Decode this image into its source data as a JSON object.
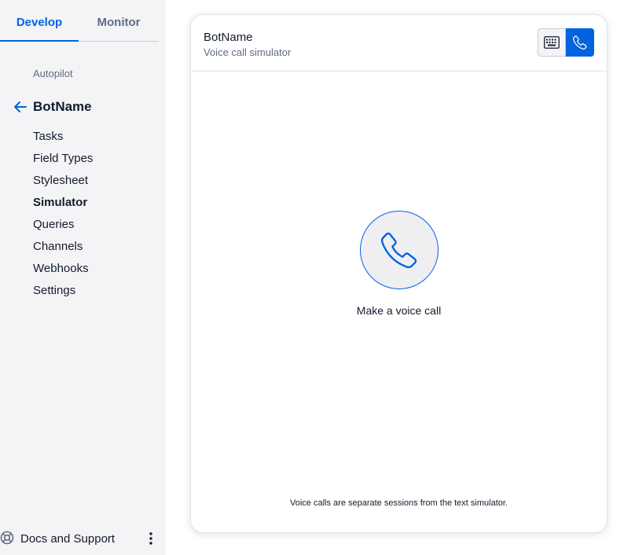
{
  "tabs": {
    "develop": "Develop",
    "monitor": "Monitor"
  },
  "sidebar": {
    "section_label": "Autopilot",
    "bot_name": "BotName",
    "items": [
      "Tasks",
      "Field Types",
      "Stylesheet",
      "Simulator",
      "Queries",
      "Channels",
      "Webhooks",
      "Settings"
    ],
    "active_item": "Simulator",
    "footer_label": "Docs and Support"
  },
  "simulator": {
    "title": "BotName",
    "subtitle": "Voice call simulator",
    "call_label": "Make a voice call",
    "note": "Voice calls are separate sessions from the text simulator."
  },
  "colors": {
    "accent": "#0263e0",
    "sidebar_bg": "#f4f4f6",
    "text": "#121c2d",
    "muted": "#606b85"
  },
  "icons": [
    "arrow-left-icon",
    "lifebuoy-icon",
    "kebab-menu-icon",
    "keypad-icon",
    "phone-icon"
  ]
}
